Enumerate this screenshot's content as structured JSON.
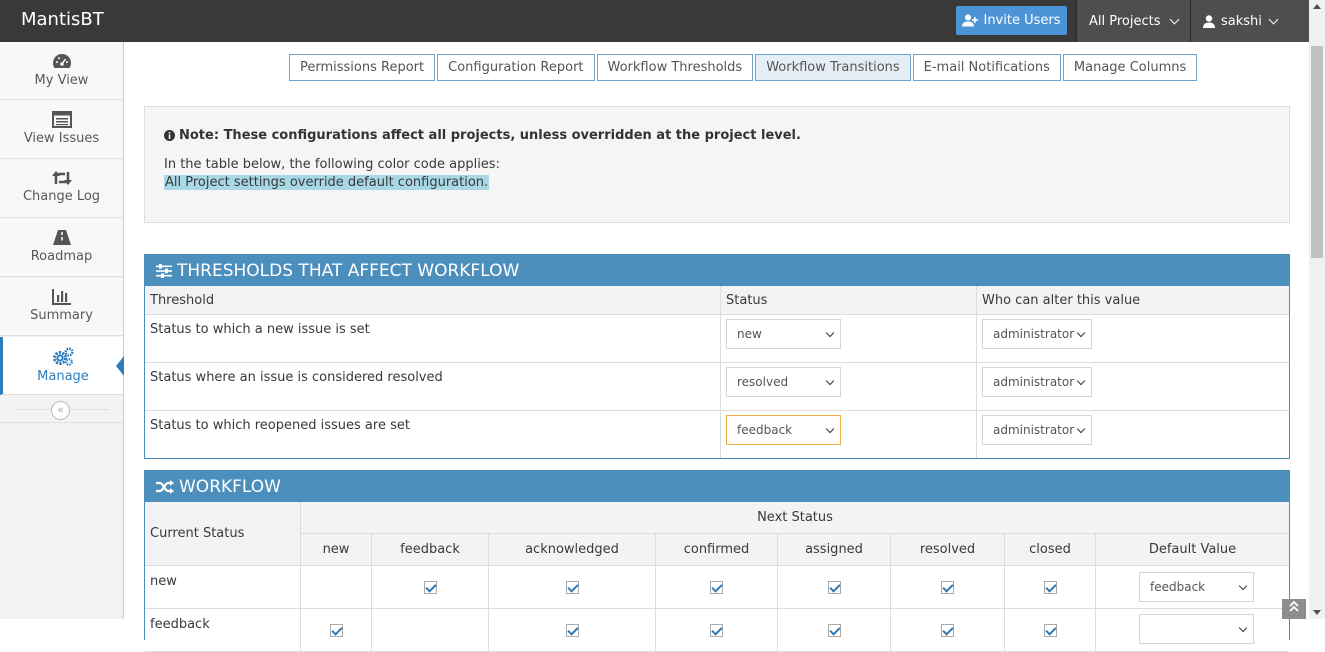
{
  "navbar": {
    "brand": "MantisBT",
    "invite_label": "Invite Users",
    "project_label": "All Projects",
    "user_label": "sakshi"
  },
  "sidebar": {
    "items": [
      {
        "label": "My View",
        "icon": "dashboard-icon"
      },
      {
        "label": "View Issues",
        "icon": "list-icon"
      },
      {
        "label": "Change Log",
        "icon": "retweet-icon"
      },
      {
        "label": "Roadmap",
        "icon": "road-icon"
      },
      {
        "label": "Summary",
        "icon": "bar-chart-icon"
      },
      {
        "label": "Manage",
        "icon": "gears-icon"
      }
    ],
    "collapse_glyph": "«"
  },
  "tabs": [
    "Permissions Report",
    "Configuration Report",
    "Workflow Thresholds",
    "Workflow Transitions",
    "E-mail Notifications",
    "Manage Columns"
  ],
  "active_tab": "Workflow Transitions",
  "note": {
    "title": "Note: These configurations affect all projects, unless overridden at the project level.",
    "line": "In the table below, the following color code applies:",
    "highlight": "All Project settings override default configuration."
  },
  "thresholds": {
    "title": "THRESHOLDS THAT AFFECT WORKFLOW",
    "headers": [
      "Threshold",
      "Status",
      "Who can alter this value"
    ],
    "rows": [
      {
        "label": "Status to which a new issue is set",
        "status": "new",
        "who": "administrator"
      },
      {
        "label": "Status where an issue is considered resolved",
        "status": "resolved",
        "who": "administrator"
      },
      {
        "label": "Status to which reopened issues are set",
        "status": "feedback",
        "who": "administrator"
      }
    ]
  },
  "workflow": {
    "title": "WORKFLOW",
    "current_status_label": "Current Status",
    "next_status_label": "Next Status",
    "columns": [
      "new",
      "feedback",
      "acknowledged",
      "confirmed",
      "assigned",
      "resolved",
      "closed",
      "Default Value"
    ],
    "rows": [
      {
        "status": "new",
        "default": "feedback"
      },
      {
        "status": "feedback",
        "default": ""
      }
    ]
  },
  "colors": {
    "accent": "#4c8fbd",
    "navbar": "#393939",
    "highlight": "#a8d8e6"
  }
}
